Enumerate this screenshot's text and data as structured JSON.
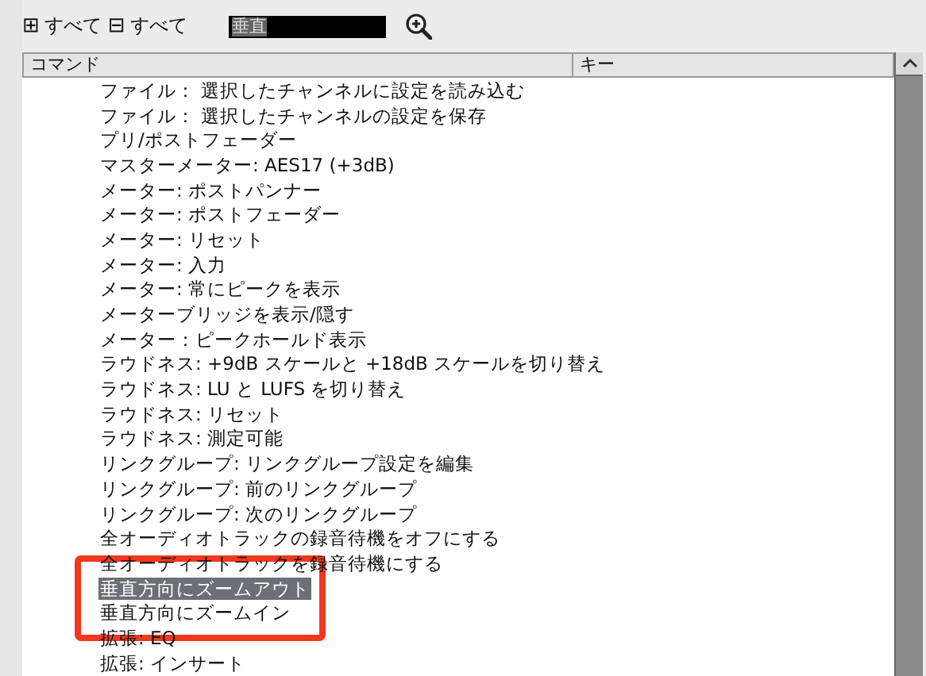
{
  "toolbar": {
    "expand_all": {
      "icon": "⊞",
      "label": "すべて"
    },
    "collapse_all": {
      "icon": "⊟",
      "label": "すべて"
    },
    "search": {
      "value": "垂直"
    }
  },
  "table": {
    "columns": [
      "コマンド",
      "キー"
    ],
    "rows": [
      {
        "command": "ファイル： 選択したチャンネルに設定を読み込む",
        "selected": false
      },
      {
        "command": "ファイル： 選択したチャンネルの設定を保存",
        "selected": false
      },
      {
        "command": "プリ/ポストフェーダー",
        "selected": false
      },
      {
        "command": "マスターメーター: AES17 (+3dB)",
        "selected": false
      },
      {
        "command": "メーター: ポストパンナー",
        "selected": false
      },
      {
        "command": "メーター: ポストフェーダー",
        "selected": false
      },
      {
        "command": "メーター: リセット",
        "selected": false
      },
      {
        "command": "メーター: 入力",
        "selected": false
      },
      {
        "command": "メーター: 常にピークを表示",
        "selected": false
      },
      {
        "command": "メーターブリッジを表示/隠す",
        "selected": false
      },
      {
        "command": "メーター：ピークホールド表示",
        "selected": false
      },
      {
        "command": "ラウドネス: +9dB スケールと +18dB スケールを切り替え",
        "selected": false
      },
      {
        "command": "ラウドネス: LU と LUFS を切り替え",
        "selected": false
      },
      {
        "command": "ラウドネス: リセット",
        "selected": false
      },
      {
        "command": "ラウドネス: 測定可能",
        "selected": false
      },
      {
        "command": "リンクグループ: リンクグループ設定を編集",
        "selected": false
      },
      {
        "command": "リンクグループ: 前のリンクグループ",
        "selected": false
      },
      {
        "command": "リンクグループ: 次のリンクグループ",
        "selected": false
      },
      {
        "command": "全オーディオトラックの録音待機をオフにする",
        "selected": false
      },
      {
        "command": "全オーディオトラックを録音待機にする",
        "selected": false
      },
      {
        "command": "垂直方向にズームアウト",
        "selected": true
      },
      {
        "command": "垂直方向にズームイン",
        "selected": false
      },
      {
        "command": "拡張: EQ",
        "selected": false
      },
      {
        "command": "拡張: インサート",
        "selected": false
      }
    ]
  }
}
